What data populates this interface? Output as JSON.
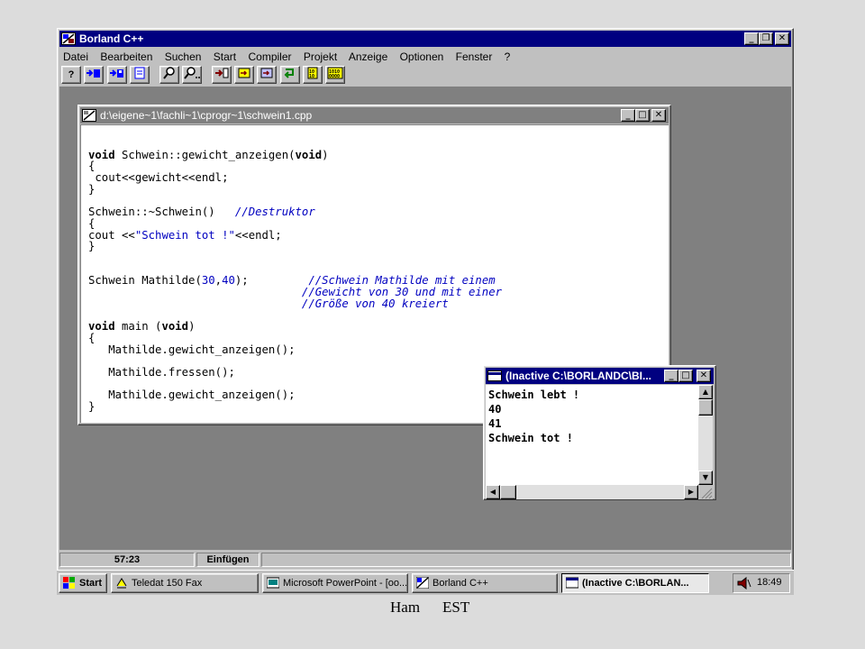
{
  "app": {
    "title": "Borland C++",
    "menu": [
      "Datei",
      "Bearbeiten",
      "Suchen",
      "Start",
      "Compiler",
      "Projekt",
      "Anzeige",
      "Optionen",
      "Fenster",
      "?"
    ]
  },
  "toolbar": {
    "help": "?",
    "tools": [
      "open-file",
      "save-file",
      "browse",
      "find",
      "find-next",
      "compile",
      "make",
      "build",
      "step",
      "debug",
      "inspect"
    ]
  },
  "editor": {
    "title": "d:\\eigene~1\\fachli~1\\cprogr~1\\schwein1.cpp",
    "lines": {
      "l1_kw": "void",
      "l1_rest": " Schwein::gewicht_anzeigen(",
      "l1_kw2": "void",
      "l1_end": ")",
      "l2": "{",
      "l3": " cout<<gewicht<<endl;",
      "l4": "}",
      "l5_code": "Schwein::~Schwein()",
      "l5_comment": "//Destruktor",
      "l6": "{",
      "l7_a": "cout <<",
      "l7_str": "\"Schwein tot !\"",
      "l7_b": "<<endl;",
      "l8": "}",
      "l9_a": "Schwein Mathilde(",
      "l9_n1": "30",
      "l9_comma": ",",
      "l9_n2": "40",
      "l9_b": ");",
      "l9_comment": "//Schwein Mathilde mit einem",
      "l10_comment": "//Gewicht von 30 und mit einer",
      "l11_comment": "//Größe von 40 kreiert",
      "l12_kw": "void",
      "l12_rest": " main (",
      "l12_kw2": "void",
      "l12_end": ")",
      "l13": "{",
      "l14": "   Mathilde.gewicht_anzeigen();",
      "l15": "   Mathilde.fressen();",
      "l16": "   Mathilde.gewicht_anzeigen();",
      "l17": "}"
    }
  },
  "console": {
    "title": "(Inactive C:\\BORLANDC\\BI...",
    "lines": [
      "Schwein lebt !",
      "40",
      "41",
      "Schwein tot !"
    ]
  },
  "statusbar": {
    "position": "57:23",
    "mode": "Einfügen"
  },
  "taskbar": {
    "start": "Start",
    "items": [
      {
        "label": "Teledat 150 Fax"
      },
      {
        "label": "Microsoft PowerPoint - [oo..."
      },
      {
        "label": "Borland C++"
      },
      {
        "label": "(Inactive C:\\BORLAN..."
      }
    ],
    "clock": "18:49"
  },
  "footer": {
    "left": "Ham",
    "right": "EST"
  },
  "colors": {
    "title_active": "#000080",
    "title_inactive": "#808080",
    "desktop": "#808080",
    "comment": "#0000c0"
  }
}
